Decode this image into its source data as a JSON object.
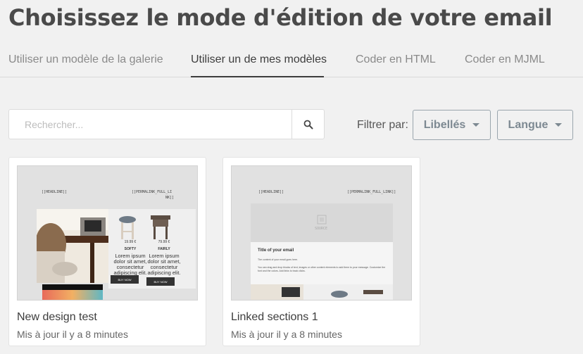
{
  "page": {
    "title": "Choisissez le mode d'édition de votre email"
  },
  "tabs": [
    {
      "label": "Utiliser un modèle de la galerie",
      "active": false
    },
    {
      "label": "Utiliser un de mes modèles",
      "active": true
    },
    {
      "label": "Coder en HTML",
      "active": false
    },
    {
      "label": "Coder en MJML",
      "active": false
    }
  ],
  "search": {
    "placeholder": "Rechercher...",
    "icon": "search-icon"
  },
  "filters": {
    "label": "Filtrer par:",
    "labels_dropdown": "Libellés",
    "language_dropdown": "Langue"
  },
  "templates": [
    {
      "name": "New design test",
      "updated": "Mis à jour il y a 8 minutes",
      "preview": {
        "headline": "[[HEADLINE]]",
        "permalink_line1": "[[PERMALINK_FULL_LI",
        "permalink_line2": "NK]]",
        "products": [
          {
            "price": "19.99 €",
            "name": "SOFTY",
            "desc": "Lorem ipsum dolor sit amet, consectetur adipiscing elit.",
            "button": "BUY NOW"
          },
          {
            "price": "79.99 €",
            "name": "FAIRLY",
            "desc": "Lorem ipsum dolor sit amet, consectetur adipiscing elit.",
            "button": "BUY NOW"
          }
        ]
      }
    },
    {
      "name": "Linked sections 1",
      "updated": "Mis à jour il y a 8 minutes",
      "preview": {
        "headline": "[[HEADLINE]]",
        "permalink": "[[PERMALINK_FULL_LINK]]",
        "logo": "SOURCE",
        "heading": "Title of your email",
        "line1": "The content of your email goes here.",
        "line2": "You can drag and drop blocks of text, images or other content elements to add them to your message. Customize the font and the colors. Add links to track clicks."
      }
    }
  ],
  "colors": {
    "background": "#f1f1f1",
    "text_dark": "#3d3d3d",
    "dropdown_border": "#9aa5ad",
    "dropdown_text": "#7d8992"
  }
}
